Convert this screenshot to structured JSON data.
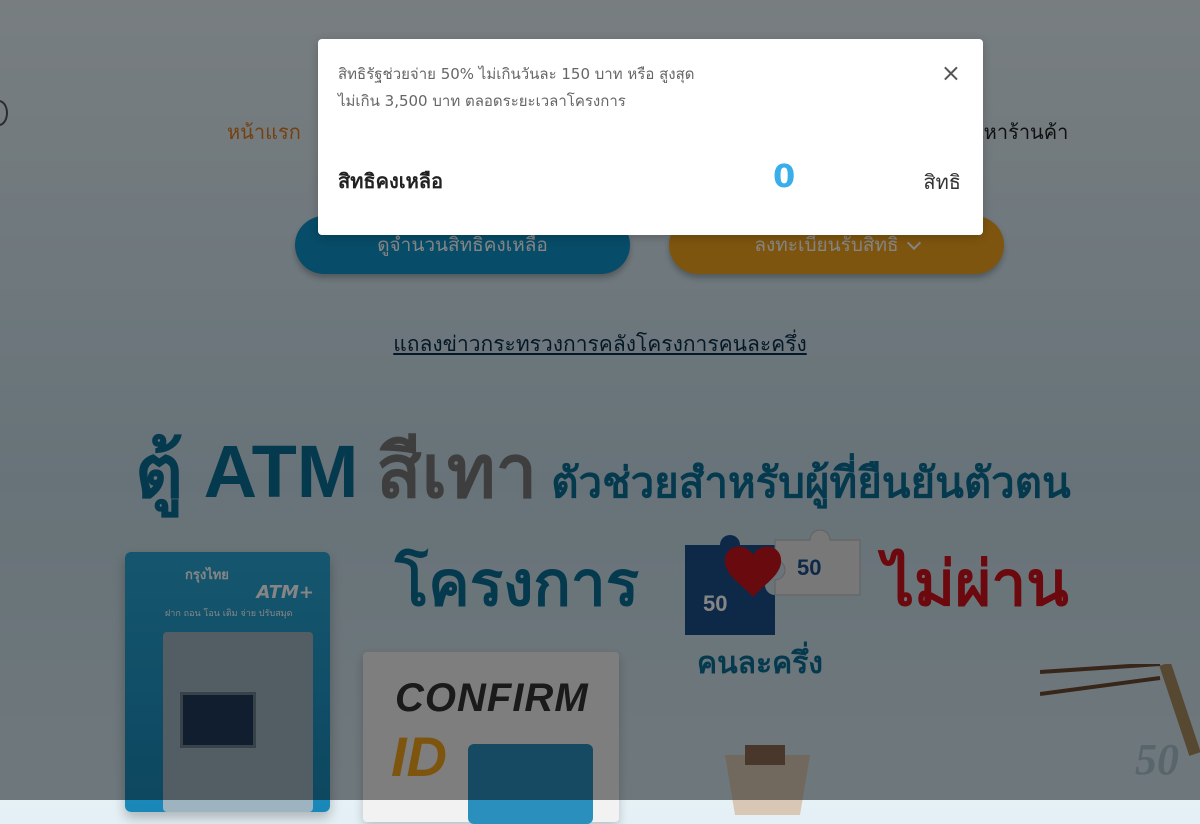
{
  "nav": {
    "home": "หน้าแรก",
    "find_shop": "นหาร้านค้า"
  },
  "buttons": {
    "check_rights": "ดูจำนวนสิทธิคงเหลือ",
    "register": "ลงทะเบียนรับสิทธิ"
  },
  "news_link": "แถลงข่าวกระทรวงการคลังโครงการคนละครึ่ง",
  "banner": {
    "atm_text": "ตู้ ATM",
    "grey_text": "สีเทา",
    "helper_text": "ตัวช่วยสำหรับผู้ที่ยืนยันตัวตน",
    "project_text": "โครงการ",
    "fail_text": "ไม่ผ่าน",
    "logo_caption": "คนละครึ่ง",
    "logo_left_num": "50",
    "logo_right_num": "50",
    "atm_brand": "กรุงไทย",
    "atm_plus": "ATM+",
    "atm_sub": "ฝาก ถอน โอน เติม จ่าย ปรับสมุด",
    "confirm_word": "CONFIRM",
    "id_word": "ID",
    "corner_num": "50"
  },
  "modal": {
    "desc_line1": "สิทธิรัฐช่วยจ่าย 50% ไม่เกินวันละ 150 บาท หรือ สูงสุด",
    "desc_line2": "ไม่เกิน 3,500 บาท ตลอดระยะเวลาโครงการ",
    "remaining_label": "สิทธิคงเหลือ",
    "remaining_value": "0",
    "unit": "สิทธิ",
    "close": "×"
  },
  "icons": {
    "close": "close-icon",
    "chevron": "chevron-down-icon"
  }
}
